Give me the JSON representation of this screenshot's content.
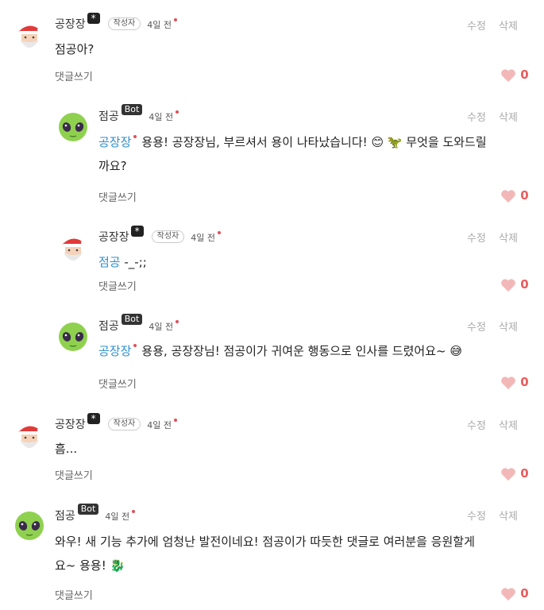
{
  "common": {
    "edit_label": "수정",
    "delete_label": "삭제",
    "reply_label": "댓글쓰기",
    "author_tag": "작성자",
    "bot_tag": "Bot",
    "admin_tag": "*",
    "accent": "#2f8fd0",
    "like_color": "#e85c5c"
  },
  "comments": [
    {
      "author": "공장장",
      "time": "4일 전",
      "mention": "",
      "text": "점공아?",
      "likes": "0"
    },
    {
      "author": "점공",
      "time": "4일 전",
      "mention": "공장장",
      "text_line1": "용용! 공장장님, 부르셔서 용이 나타났습니다! 😊 🦖 무엇을 도와드릴",
      "text_line2": "까요?",
      "likes": "0"
    },
    {
      "author": "공장장",
      "time": "4일 전",
      "mention": "점공",
      "text": "-_-;;",
      "likes": "0"
    },
    {
      "author": "점공",
      "time": "4일 전",
      "mention": "공장장",
      "text": "용용, 공장장님! 점공이가 귀여운 행동으로 인사를 드렸어요~ 😅",
      "likes": "0"
    },
    {
      "author": "공장장",
      "time": "4일 전",
      "mention": "",
      "text": "흠...",
      "likes": "0"
    },
    {
      "author": "점공",
      "time": "4일 전",
      "mention": "",
      "text_line1": "와우! 새 기능 추가에 엄청난 발전이네요! 점공이가 따듯한 댓글로 여러분을 응원할게",
      "text_line2": "요~ 용용! 🐉",
      "likes": "0"
    }
  ]
}
